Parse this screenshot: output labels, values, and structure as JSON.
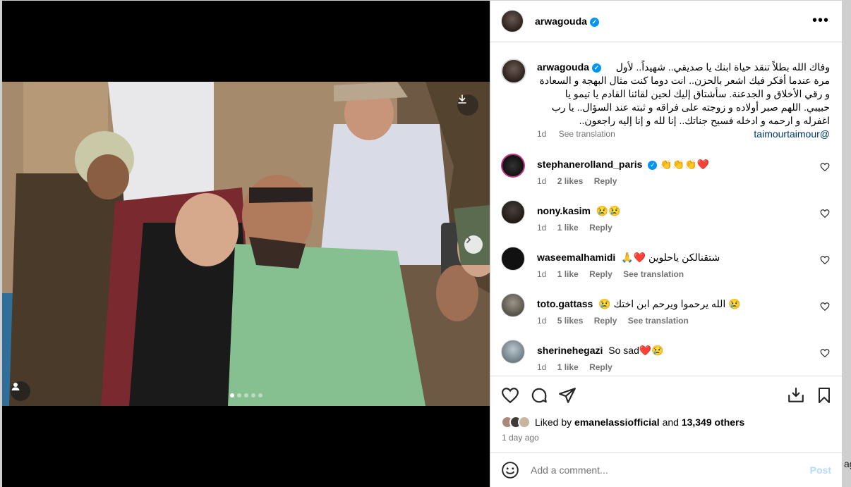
{
  "post": {
    "username": "arwagouda",
    "verified_icon": "verified-badge-icon",
    "caption": "وفاك الله بطلاً تنقذ حياة ابنك يا صديقي.. شهيداً.. لأول مرة عندما أفكر فيك اشعر بالحزن.. انت دوما كنت مثال البهجة و السعادة و رقي الأخلاق و الجدعنة. سأشتاق إليك لحين لقائنا القادم يا تيمو يا حبيبي. اللهم صبر أولاده و زوجته على فراقه و ثبته عند السؤال.. يا رب اغفرله و ارحمه و ادخله فسيح جناتك.. إنا لله و إنا إليه راجعون..",
    "mention": "@taimourtaimour",
    "caption_time": "1d",
    "see_translation": "See translation"
  },
  "comments": [
    {
      "user": "stephanerolland_paris",
      "verified": true,
      "text": "👏👏👏❤️",
      "time": "1d",
      "likes": "2 likes",
      "reply": "Reply",
      "translate": ""
    },
    {
      "user": "nony.kasim",
      "verified": false,
      "text": "😢😢",
      "time": "1d",
      "likes": "1 like",
      "reply": "Reply",
      "translate": ""
    },
    {
      "user": "waseemalhamidi",
      "verified": false,
      "text": "🙏❤️ شتقنالكن ياحلوين",
      "time": "1d",
      "likes": "1 like",
      "reply": "Reply",
      "translate": "See translation"
    },
    {
      "user": "toto.gattass",
      "verified": false,
      "text": "😢 الله يرحموا ويرحم ابن اختك 😢",
      "time": "1d",
      "likes": "5 likes",
      "reply": "Reply",
      "translate": "See translation"
    },
    {
      "user": "sherinehegazi",
      "verified": false,
      "text": "So sad❤️😢",
      "time": "1d",
      "likes": "1 like",
      "reply": "Reply",
      "translate": ""
    }
  ],
  "actions": {
    "liked_by_prefix": "Liked by",
    "liked_by_user": "emanelassiofficial",
    "liked_by_and": "and",
    "liked_by_others": "13,349 others",
    "date": "1 day ago"
  },
  "composer": {
    "placeholder": "Add a comment...",
    "post_label": "Post"
  },
  "carousel": {
    "slide_count": 5,
    "active_slide": 1
  },
  "edge_text": "ag",
  "colors": {
    "link": "#00376b",
    "verified": "#0095f6",
    "post_disabled": "#b3dbff",
    "muted": "#737373"
  }
}
